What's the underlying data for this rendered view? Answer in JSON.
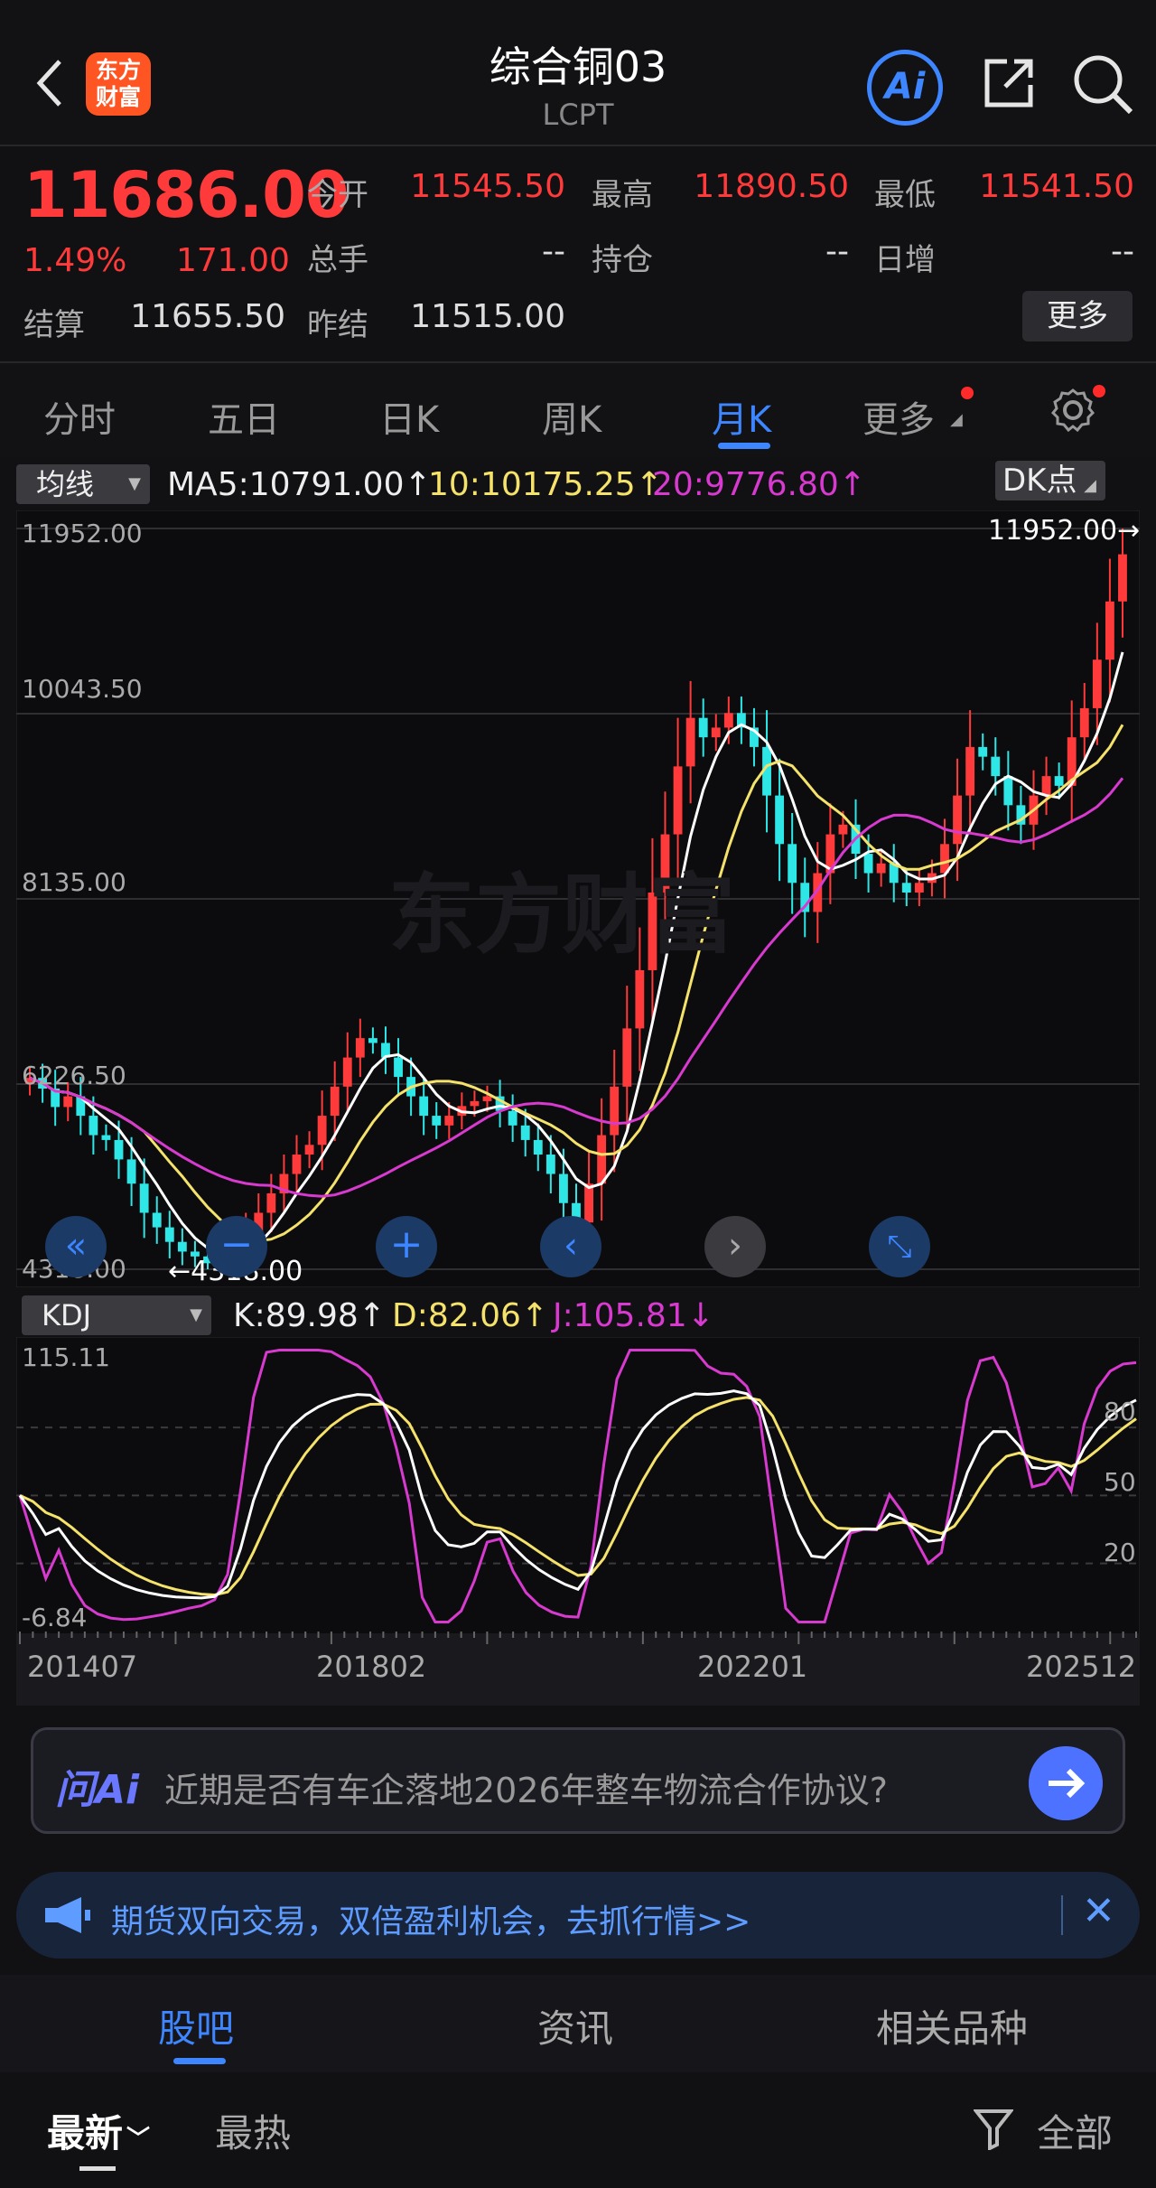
{
  "header": {
    "logo_text": "东方\n财富",
    "title": "综合铜03",
    "code": "LCPT",
    "ai_label": "Ai",
    "accent": "#3d86ff",
    "logo_color": "#ff5522"
  },
  "quote": {
    "price": "11686.00",
    "change_pct": "1.49%",
    "change": "171.00",
    "fields": [
      {
        "label": "今开",
        "value": "11545.50"
      },
      {
        "label": "最高",
        "value": "11890.50"
      },
      {
        "label": "最低",
        "value": "11541.50"
      },
      {
        "label": "总手",
        "value": "--"
      },
      {
        "label": "持仓",
        "value": "--"
      },
      {
        "label": "日增",
        "value": "--"
      },
      {
        "label": "结算",
        "value": "11655.50"
      },
      {
        "label": "昨结",
        "value": "11515.00"
      }
    ],
    "more_label": "更多",
    "up_color": "#ff3a3a"
  },
  "tabs": [
    "分时",
    "五日",
    "日K",
    "周K",
    "月K",
    "更多"
  ],
  "active_tab": "月K",
  "indicator": {
    "selector": "均线",
    "ma5": "MA5:10791.00↑",
    "ma10": "10:10175.25↑",
    "ma20": "20:9776.80↑",
    "dk_label": "DK点"
  },
  "main_axis": [
    "11952.00",
    "10043.50",
    "8135.00",
    "6226.50",
    "4318.00"
  ],
  "high_marker": "11952.00→",
  "low_marker": "←4318.00",
  "watermark": "东方财富",
  "kdj": {
    "selector": "KDJ",
    "k": "K:89.98↑",
    "d": "D:82.06↑",
    "j": "J:105.81↓",
    "axis_top": "115.11",
    "axis_bottom": "-6.84",
    "levels": [
      "80",
      "50",
      "20"
    ]
  },
  "dates": [
    "201407",
    "201802",
    "202201",
    "202512"
  ],
  "ask": {
    "brand": "问Ai",
    "text": "近期是否有车企落地2026年整车物流合作协议?"
  },
  "promo": {
    "text": "期货双向交易，双倍盈利机会，去抓行情>>"
  },
  "bottom_tabs": [
    "股吧",
    "资讯",
    "相关品种"
  ],
  "filters": {
    "latest": "最新",
    "hot": "最热",
    "all": "全部"
  },
  "chart_data": [
    {
      "type": "candlestick",
      "title": "",
      "x_range": [
        "201407",
        "202512"
      ],
      "ylim": [
        4318.0,
        11952.0
      ],
      "ticks": [
        11952.0,
        10043.5,
        8135.0,
        6226.5,
        4318.0
      ],
      "series": [
        {
          "name": "MA5",
          "last": 10791.0,
          "color": "#ffffff"
        },
        {
          "name": "10",
          "last": 10175.25,
          "color": "#f5e26b"
        },
        {
          "name": "20",
          "last": 9776.8,
          "color": "#d83ad0"
        }
      ],
      "close": [
        6290,
        6180,
        5990,
        6100,
        5900,
        5700,
        5650,
        5450,
        5200,
        4900,
        4750,
        4600,
        4500,
        4450,
        4380,
        4400,
        4500,
        4700,
        4900,
        5100,
        5300,
        5500,
        5600,
        5900,
        6200,
        6500,
        6700,
        6650,
        6500,
        6300,
        6100,
        5900,
        5800,
        5900,
        6000,
        6050,
        6100,
        5950,
        5800,
        5650,
        5500,
        5300,
        5000,
        4800,
        5200,
        5700,
        6200,
        6800,
        7400,
        8200,
        8800,
        9500,
        10000,
        9800,
        9900,
        10050,
        9900,
        9700,
        9200,
        8700,
        8300,
        8000,
        8400,
        8800,
        8900,
        8600,
        8400,
        8500,
        8300,
        8200,
        8300,
        8400,
        8700,
        9200,
        9700,
        9600,
        9400,
        9100,
        8900,
        9200,
        9400,
        9300,
        9800,
        10100,
        10600,
        11200,
        11686
      ]
    },
    {
      "type": "line",
      "title": "",
      "ylim": [
        -6.84,
        115.11
      ],
      "levels": [
        80,
        50,
        20
      ],
      "series": [
        {
          "name": "K",
          "last": 89.98,
          "color": "#ffffff"
        },
        {
          "name": "D",
          "last": 82.06,
          "color": "#f5e26b"
        },
        {
          "name": "J",
          "last": 105.81,
          "color": "#d83ad0"
        }
      ]
    }
  ]
}
